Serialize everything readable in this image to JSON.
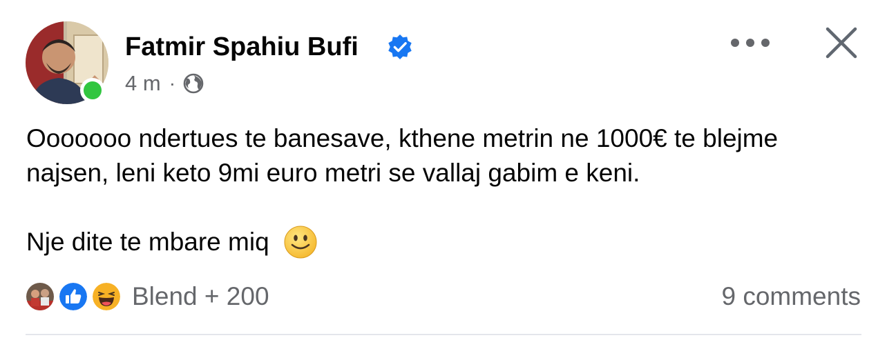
{
  "post": {
    "author": {
      "name": "Fatmir Spahiu Bufi",
      "verified": true,
      "online": true,
      "avatar_icon": "profile-photo"
    },
    "time": "4 m",
    "separator": "·",
    "audience_icon": "globe-icon",
    "text": {
      "paragraph1": "Ooooooo ndertues te banesave, kthene metrin ne 1000€ te blejme najsen, leni keto 9mi euro metri se vallaj gabim e keni.",
      "paragraph2": "Nje dite te mbare miq"
    },
    "emoji_icon": "slightly-smiling-face",
    "reactions": {
      "icons": [
        "friend-photo",
        "like-icon",
        "haha-icon"
      ],
      "summary": "Blend + 200"
    },
    "comments": "9 comments"
  },
  "colors": {
    "verified": "#1877f2",
    "online": "#31c640",
    "secondary_text": "#65676b",
    "like": "#1877f2",
    "haha": "#f7b125"
  }
}
